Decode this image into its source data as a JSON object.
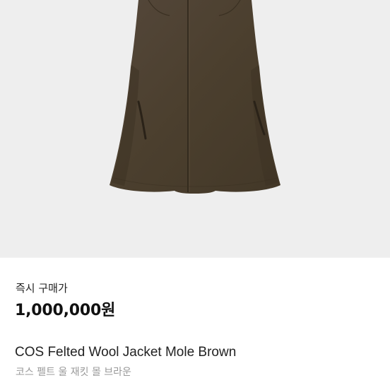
{
  "product": {
    "image_alt": "COS Felted Wool Jacket Mole Brown",
    "image_background": "#eeeeee",
    "jacket_color": "#4b3f2e"
  },
  "purchase": {
    "label": "즉시 구매가",
    "price": "1,000,000원"
  },
  "listing": {
    "title": "COS Felted Wool Jacket Mole Brown",
    "subtitle": "코스 펠트 울 재킷 몰 브라운"
  }
}
